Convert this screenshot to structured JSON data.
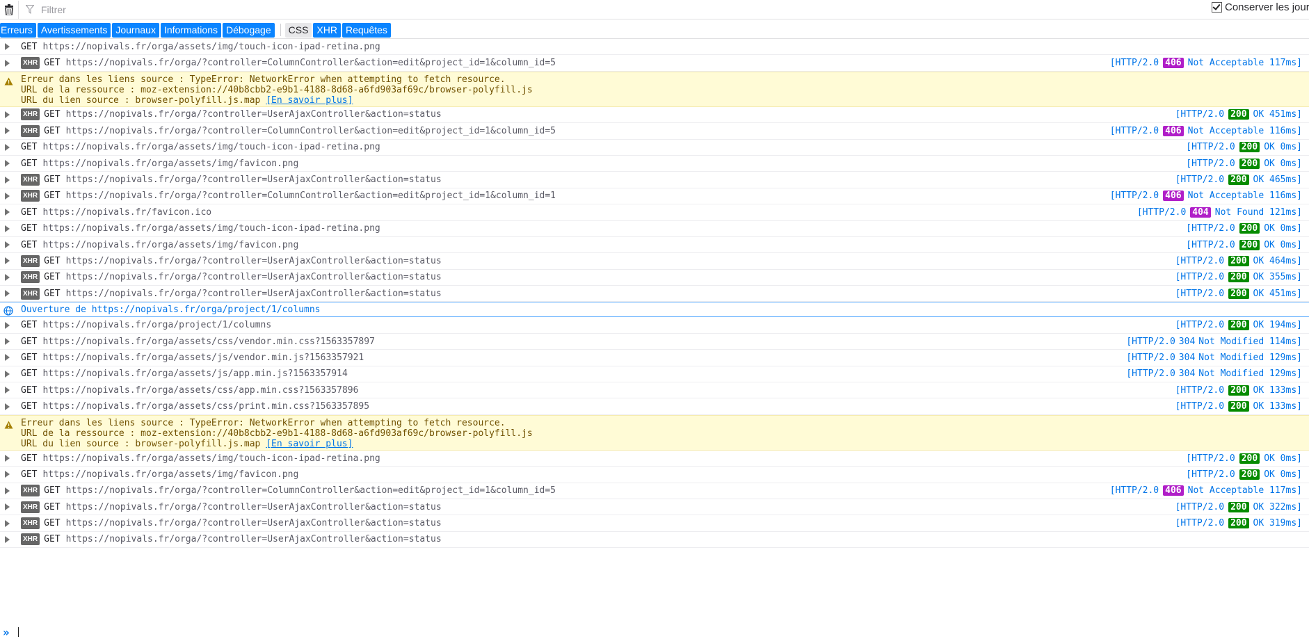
{
  "toolbar": {
    "filter_placeholder": "Filtrer",
    "persist_label": "Conserver les journ"
  },
  "categories": [
    {
      "label": "Erreurs",
      "active": true
    },
    {
      "label": "Avertissements",
      "active": true
    },
    {
      "label": "Journaux",
      "active": true
    },
    {
      "label": "Informations",
      "active": true
    },
    {
      "label": "Débogage",
      "active": true
    },
    {
      "label": "CSS",
      "active": false
    },
    {
      "label": "XHR",
      "active": true
    },
    {
      "label": "Requêtes",
      "active": true
    }
  ],
  "warning": {
    "line1": "Erreur dans les liens source : TypeError: NetworkError when attempting to fetch resource.",
    "line2": "URL de la ressource : moz-extension://40b8cbb2-e9b1-4188-8d68-a6fd903af69c/browser-polyfill.js",
    "line3_prefix": "URL du lien source : browser-polyfill.js.map ",
    "learn_more": "[En savoir plus]"
  },
  "navigation": "Ouverture de https://nopivals.fr/orga/project/1/columns",
  "entries": [
    {
      "type": "req",
      "xhr": false,
      "method": "GET",
      "url": "https://nopivals.fr/orga/assets/img/touch-icon-ipad-retina.png",
      "status": null
    },
    {
      "type": "req",
      "xhr": true,
      "method": "GET",
      "url": "https://nopivals.fr/orga/?controller=ColumnController&action=edit&project_id=1&column_id=5",
      "status": {
        "proto": "[HTTP/2.0",
        "code": "406",
        "text": "Not Acceptable 117ms]"
      }
    },
    {
      "type": "warn"
    },
    {
      "type": "req",
      "xhr": true,
      "method": "GET",
      "url": "https://nopivals.fr/orga/?controller=UserAjaxController&action=status",
      "status": {
        "proto": "[HTTP/2.0",
        "code": "200",
        "text": "OK 451ms]"
      }
    },
    {
      "type": "req",
      "xhr": true,
      "method": "GET",
      "url": "https://nopivals.fr/orga/?controller=ColumnController&action=edit&project_id=1&column_id=5",
      "status": {
        "proto": "[HTTP/2.0",
        "code": "406",
        "text": "Not Acceptable 116ms]"
      }
    },
    {
      "type": "req",
      "xhr": false,
      "method": "GET",
      "url": "https://nopivals.fr/orga/assets/img/touch-icon-ipad-retina.png",
      "status": {
        "proto": "[HTTP/2.0",
        "code": "200",
        "text": "OK 0ms]"
      }
    },
    {
      "type": "req",
      "xhr": false,
      "method": "GET",
      "url": "https://nopivals.fr/orga/assets/img/favicon.png",
      "status": {
        "proto": "[HTTP/2.0",
        "code": "200",
        "text": "OK 0ms]"
      }
    },
    {
      "type": "req",
      "xhr": true,
      "method": "GET",
      "url": "https://nopivals.fr/orga/?controller=UserAjaxController&action=status",
      "status": {
        "proto": "[HTTP/2.0",
        "code": "200",
        "text": "OK 465ms]"
      }
    },
    {
      "type": "req",
      "xhr": true,
      "method": "GET",
      "url": "https://nopivals.fr/orga/?controller=ColumnController&action=edit&project_id=1&column_id=1",
      "status": {
        "proto": "[HTTP/2.0",
        "code": "406",
        "text": "Not Acceptable 116ms]"
      }
    },
    {
      "type": "req",
      "xhr": false,
      "method": "GET",
      "url": "https://nopivals.fr/favicon.ico",
      "status": {
        "proto": "[HTTP/2.0",
        "code": "404",
        "text": "Not Found 121ms]"
      }
    },
    {
      "type": "req",
      "xhr": false,
      "method": "GET",
      "url": "https://nopivals.fr/orga/assets/img/touch-icon-ipad-retina.png",
      "status": {
        "proto": "[HTTP/2.0",
        "code": "200",
        "text": "OK 0ms]"
      }
    },
    {
      "type": "req",
      "xhr": false,
      "method": "GET",
      "url": "https://nopivals.fr/orga/assets/img/favicon.png",
      "status": {
        "proto": "[HTTP/2.0",
        "code": "200",
        "text": "OK 0ms]"
      }
    },
    {
      "type": "req",
      "xhr": true,
      "method": "GET",
      "url": "https://nopivals.fr/orga/?controller=UserAjaxController&action=status",
      "status": {
        "proto": "[HTTP/2.0",
        "code": "200",
        "text": "OK 464ms]"
      }
    },
    {
      "type": "req",
      "xhr": true,
      "method": "GET",
      "url": "https://nopivals.fr/orga/?controller=UserAjaxController&action=status",
      "status": {
        "proto": "[HTTP/2.0",
        "code": "200",
        "text": "OK 355ms]"
      }
    },
    {
      "type": "req",
      "xhr": true,
      "method": "GET",
      "url": "https://nopivals.fr/orga/?controller=UserAjaxController&action=status",
      "status": {
        "proto": "[HTTP/2.0",
        "code": "200",
        "text": "OK 451ms]"
      }
    },
    {
      "type": "nav"
    },
    {
      "type": "req",
      "xhr": false,
      "method": "GET",
      "url": "https://nopivals.fr/orga/project/1/columns",
      "status": {
        "proto": "[HTTP/2.0",
        "code": "200",
        "text": "OK 194ms]"
      }
    },
    {
      "type": "req",
      "xhr": false,
      "method": "GET",
      "url": "https://nopivals.fr/orga/assets/css/vendor.min.css?1563357897",
      "status": {
        "proto": "[HTTP/2.0",
        "code": "304",
        "text": "Not Modified 114ms]"
      }
    },
    {
      "type": "req",
      "xhr": false,
      "method": "GET",
      "url": "https://nopivals.fr/orga/assets/js/vendor.min.js?1563357921",
      "status": {
        "proto": "[HTTP/2.0",
        "code": "304",
        "text": "Not Modified 129ms]"
      }
    },
    {
      "type": "req",
      "xhr": false,
      "method": "GET",
      "url": "https://nopivals.fr/orga/assets/js/app.min.js?1563357914",
      "status": {
        "proto": "[HTTP/2.0",
        "code": "304",
        "text": "Not Modified 129ms]"
      }
    },
    {
      "type": "req",
      "xhr": false,
      "method": "GET",
      "url": "https://nopivals.fr/orga/assets/css/app.min.css?1563357896",
      "status": {
        "proto": "[HTTP/2.0",
        "code": "200",
        "text": "OK 133ms]"
      }
    },
    {
      "type": "req",
      "xhr": false,
      "method": "GET",
      "url": "https://nopivals.fr/orga/assets/css/print.min.css?1563357895",
      "status": {
        "proto": "[HTTP/2.0",
        "code": "200",
        "text": "OK 133ms]"
      }
    },
    {
      "type": "warn"
    },
    {
      "type": "req",
      "xhr": false,
      "method": "GET",
      "url": "https://nopivals.fr/orga/assets/img/touch-icon-ipad-retina.png",
      "status": {
        "proto": "[HTTP/2.0",
        "code": "200",
        "text": "OK 0ms]"
      }
    },
    {
      "type": "req",
      "xhr": false,
      "method": "GET",
      "url": "https://nopivals.fr/orga/assets/img/favicon.png",
      "status": {
        "proto": "[HTTP/2.0",
        "code": "200",
        "text": "OK 0ms]"
      }
    },
    {
      "type": "req",
      "xhr": true,
      "method": "GET",
      "url": "https://nopivals.fr/orga/?controller=ColumnController&action=edit&project_id=1&column_id=5",
      "status": {
        "proto": "[HTTP/2.0",
        "code": "406",
        "text": "Not Acceptable 117ms]"
      }
    },
    {
      "type": "req",
      "xhr": true,
      "method": "GET",
      "url": "https://nopivals.fr/orga/?controller=UserAjaxController&action=status",
      "status": {
        "proto": "[HTTP/2.0",
        "code": "200",
        "text": "OK 322ms]"
      }
    },
    {
      "type": "req",
      "xhr": true,
      "method": "GET",
      "url": "https://nopivals.fr/orga/?controller=UserAjaxController&action=status",
      "status": {
        "proto": "[HTTP/2.0",
        "code": "200",
        "text": "OK 319ms]"
      }
    },
    {
      "type": "req",
      "xhr": true,
      "method": "GET",
      "url": "https://nopivals.fr/orga/?controller=UserAjaxController&action=status",
      "status": null
    }
  ],
  "xhr_badge": "XHR",
  "prompt_glyph": "»",
  "icons": {
    "trash": "trash-icon",
    "filter": "filter-icon",
    "warning": "warning-icon",
    "navigation": "globe-icon"
  },
  "colors": {
    "accent": "#0a84ff",
    "ok": "#058b00",
    "error_code": "#b01ec8",
    "warning_bg": "#fffbd6"
  }
}
